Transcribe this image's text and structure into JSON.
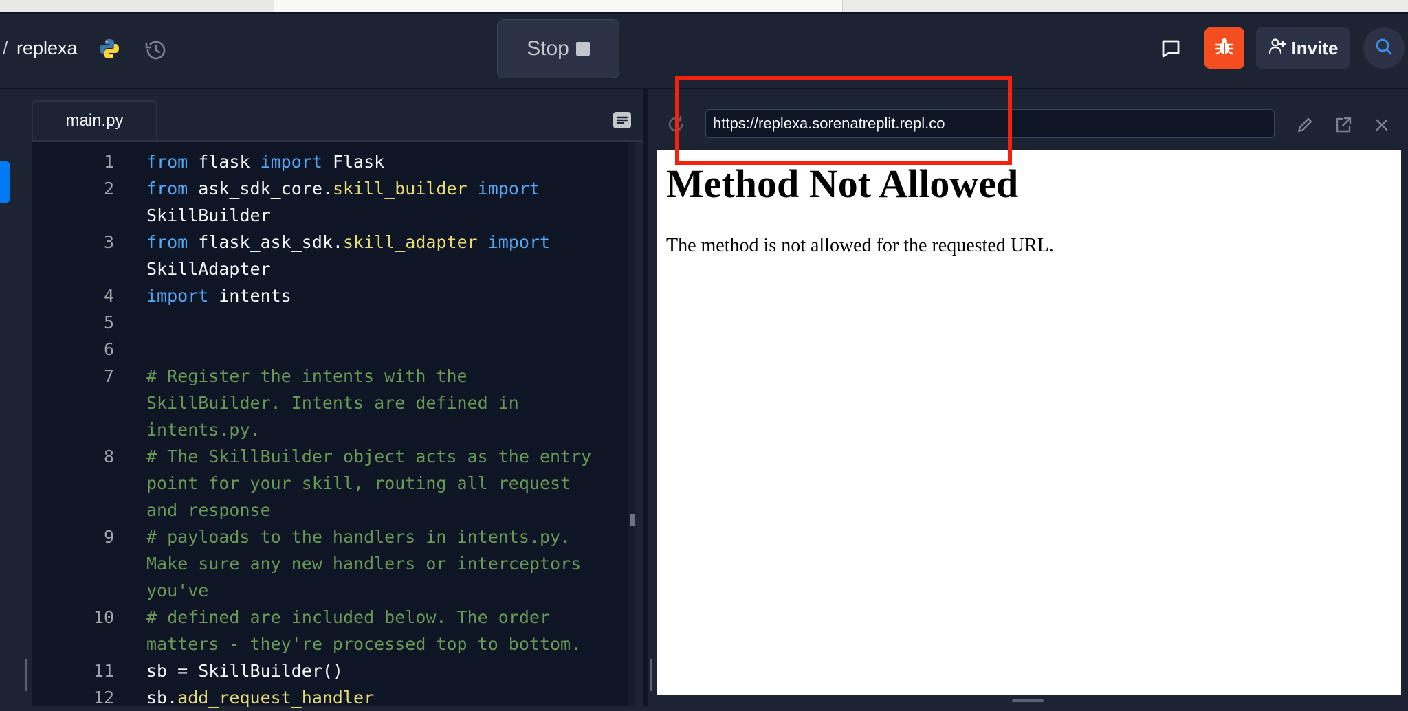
{
  "header": {
    "breadcrumb_separator": "/",
    "repl_name": "replexa",
    "stop_label": "Stop",
    "invite_label": "Invite"
  },
  "editor": {
    "tab_label": "main.py",
    "lines": [
      {
        "num": "1",
        "tokens": [
          {
            "t": "from",
            "c": "kw"
          },
          {
            "t": " flask ",
            "c": ""
          },
          {
            "t": "import",
            "c": "kw"
          },
          {
            "t": " Flask",
            "c": ""
          }
        ]
      },
      {
        "num": "2",
        "tokens": [
          {
            "t": "from",
            "c": "kw"
          },
          {
            "t": " ask_sdk_core.",
            "c": ""
          },
          {
            "t": "skill_builder",
            "c": "attr"
          },
          {
            "t": " ",
            "c": ""
          },
          {
            "t": "import",
            "c": "kw"
          }
        ]
      },
      {
        "num": "",
        "tokens": [
          {
            "t": "SkillBuilder",
            "c": ""
          }
        ]
      },
      {
        "num": "3",
        "tokens": [
          {
            "t": "from",
            "c": "kw"
          },
          {
            "t": " flask_ask_sdk.",
            "c": ""
          },
          {
            "t": "skill_adapter",
            "c": "attr"
          },
          {
            "t": " ",
            "c": ""
          },
          {
            "t": "import",
            "c": "kw"
          }
        ]
      },
      {
        "num": "",
        "tokens": [
          {
            "t": "SkillAdapter",
            "c": ""
          }
        ]
      },
      {
        "num": "4",
        "tokens": [
          {
            "t": "import",
            "c": "kw"
          },
          {
            "t": " intents",
            "c": ""
          }
        ]
      },
      {
        "num": "5",
        "tokens": []
      },
      {
        "num": "6",
        "tokens": []
      },
      {
        "num": "7",
        "tokens": [
          {
            "t": "# Register the intents with the",
            "c": "cm"
          }
        ]
      },
      {
        "num": "",
        "tokens": [
          {
            "t": "SkillBuilder. Intents are defined in",
            "c": "cm"
          }
        ]
      },
      {
        "num": "",
        "tokens": [
          {
            "t": "intents.py.",
            "c": "cm"
          }
        ]
      },
      {
        "num": "8",
        "tokens": [
          {
            "t": "# The SkillBuilder object acts as the entry",
            "c": "cm"
          }
        ]
      },
      {
        "num": "",
        "tokens": [
          {
            "t": "point for your skill, routing all request",
            "c": "cm"
          }
        ]
      },
      {
        "num": "",
        "tokens": [
          {
            "t": "and response",
            "c": "cm"
          }
        ]
      },
      {
        "num": "9",
        "tokens": [
          {
            "t": "# payloads to the handlers in intents.py.",
            "c": "cm"
          }
        ]
      },
      {
        "num": "",
        "tokens": [
          {
            "t": "Make sure any new handlers or interceptors",
            "c": "cm"
          }
        ]
      },
      {
        "num": "",
        "tokens": [
          {
            "t": "you've",
            "c": "cm"
          }
        ]
      },
      {
        "num": "10",
        "tokens": [
          {
            "t": "# defined are included below. The order",
            "c": "cm"
          }
        ]
      },
      {
        "num": "",
        "tokens": [
          {
            "t": "matters - they're processed top to bottom.",
            "c": "cm"
          }
        ]
      },
      {
        "num": "11",
        "tokens": [
          {
            "t": "sb = SkillBuilder()",
            "c": ""
          }
        ]
      },
      {
        "num": "12",
        "tokens": [
          {
            "t": "sb.",
            "c": ""
          },
          {
            "t": "add_request_handler",
            "c": "attr"
          }
        ]
      }
    ]
  },
  "webview": {
    "url": "https://replexa.sorenatreplit.repl.co",
    "heading": "Method Not Allowed",
    "message": "The method is not allowed for the requested URL."
  },
  "colors": {
    "accent": "#0079f2",
    "debug_button": "#f44d20",
    "highlight": "#f4210c"
  },
  "icons": [
    "python-icon",
    "history-icon",
    "stop-square-icon",
    "chat-icon",
    "bug-icon",
    "add-user-icon",
    "search-icon",
    "outline-icon",
    "refresh-icon",
    "edit-icon",
    "open-new-tab-icon",
    "close-icon"
  ]
}
